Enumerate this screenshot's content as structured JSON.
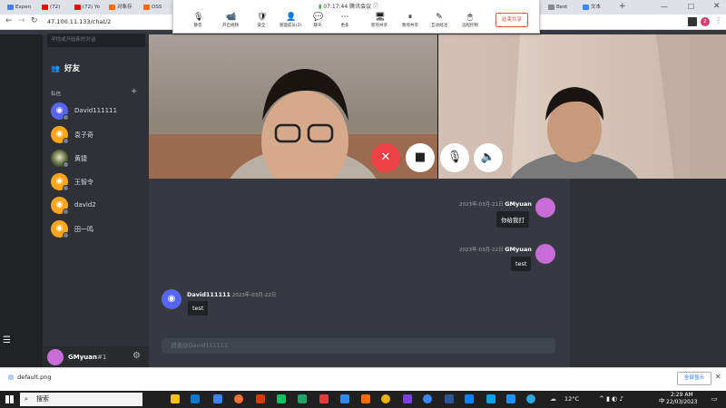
{
  "browser": {
    "tabs": [
      {
        "label": "Expen",
        "color": "#4285f4"
      },
      {
        "label": "(72)",
        "color": "#ff0000"
      },
      {
        "label": "(72) Yo",
        "color": "#ff0000"
      },
      {
        "label": "对象存",
        "color": "#ff6a00"
      },
      {
        "label": "OSS",
        "color": "#ff6a00"
      },
      {
        "label": "Best",
        "color": "#888888"
      },
      {
        "label": "文本",
        "color": "#4285f4"
      }
    ],
    "url": "47.100.11.133/chat/2"
  },
  "meeting": {
    "time": "07:17:44",
    "title": "腾讯会议",
    "items": [
      {
        "label": "静音",
        "icon": "🎙"
      },
      {
        "label": "开启视频",
        "icon": "📹"
      },
      {
        "label": "安全",
        "icon": "🛡"
      },
      {
        "label": "管理成员(2)",
        "icon": "👤"
      },
      {
        "label": "聊天",
        "icon": "💬"
      },
      {
        "label": "更多",
        "icon": "⋯"
      },
      {
        "label": "新的共享",
        "icon": "🖥"
      },
      {
        "label": "暂停共享",
        "icon": "⏸"
      },
      {
        "label": "互动批注",
        "icon": "✎"
      },
      {
        "label": "远程控制",
        "icon": "🖱"
      }
    ],
    "end_share": "结束共享"
  },
  "sidebar": {
    "search_placeholder": "寻找或开始新的对话",
    "friends_label": "好友",
    "dm_header": "私信",
    "dms": [
      {
        "name": "David111111",
        "avatar_color": "#5865f2"
      },
      {
        "name": "袁子奇",
        "avatar_color": "#faa61a"
      },
      {
        "name": "黄捷",
        "avatar_color": "#3ba55d"
      },
      {
        "name": "王智令",
        "avatar_color": "#faa61a"
      },
      {
        "name": "david2",
        "avatar_color": "#faa61a"
      },
      {
        "name": "田一鸣",
        "avatar_color": "#faa61a"
      }
    ],
    "user": {
      "name": "GMyuan",
      "tag": "#1"
    }
  },
  "chat": {
    "messages": [
      {
        "author": "GMyuan",
        "date": "2023年-03月-21日",
        "text": "你给我打"
      },
      {
        "author": "GMyuan",
        "date": "2023年-03月-22日",
        "text": "test"
      },
      {
        "author": "David111111",
        "date": "2023年-03月-22日",
        "text": "test"
      }
    ],
    "input_placeholder": "消息@David111111"
  },
  "download": {
    "file": "default.png",
    "show_all": "全部显示"
  },
  "taskbar": {
    "search": "搜索",
    "temp": "12°C",
    "lang": "中",
    "time": "2:29 AM",
    "date": "22/03/2023"
  }
}
